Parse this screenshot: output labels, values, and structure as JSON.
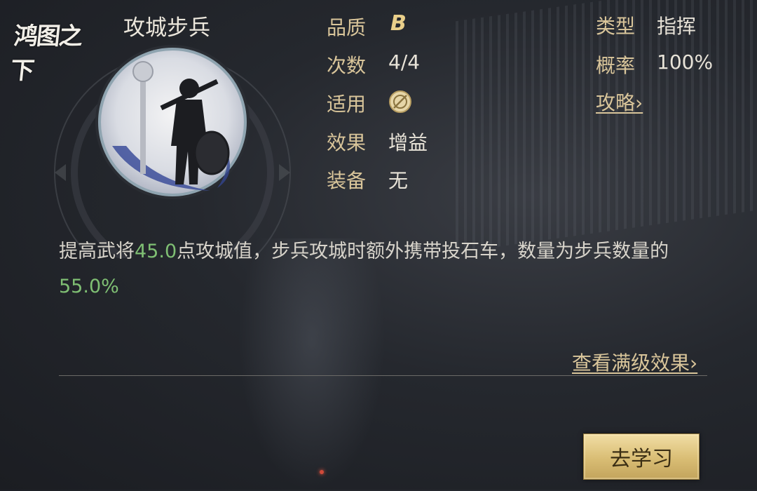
{
  "logo": {
    "text": "鸿图之下"
  },
  "skill": {
    "name": "攻城步兵"
  },
  "stats_left": [
    {
      "label": "品质",
      "value": "B"
    },
    {
      "label": "次数",
      "value": "4/4"
    },
    {
      "label": "适用",
      "value": ""
    },
    {
      "label": "效果",
      "value": "增益"
    },
    {
      "label": "装备",
      "value": "无"
    }
  ],
  "stats_right": [
    {
      "label": "类型",
      "value": "指挥"
    },
    {
      "label": "概率",
      "value": "100%"
    }
  ],
  "strategy_link": "攻略",
  "description": {
    "part1": "提高武将",
    "value1": "45.0",
    "part2": "点攻城值，步兵攻城时额外携带投石车，数量为步兵数量的",
    "value2": "55.0%"
  },
  "full_level_link": "查看满级效果",
  "learn_button": "去学习",
  "colors": {
    "gold": "#d9c59a",
    "highlight": "#7fbf73",
    "button": "#d9bd74"
  },
  "icons": {
    "applies": "slashed-circle-icon",
    "chevron": "chevron-right-icon"
  }
}
